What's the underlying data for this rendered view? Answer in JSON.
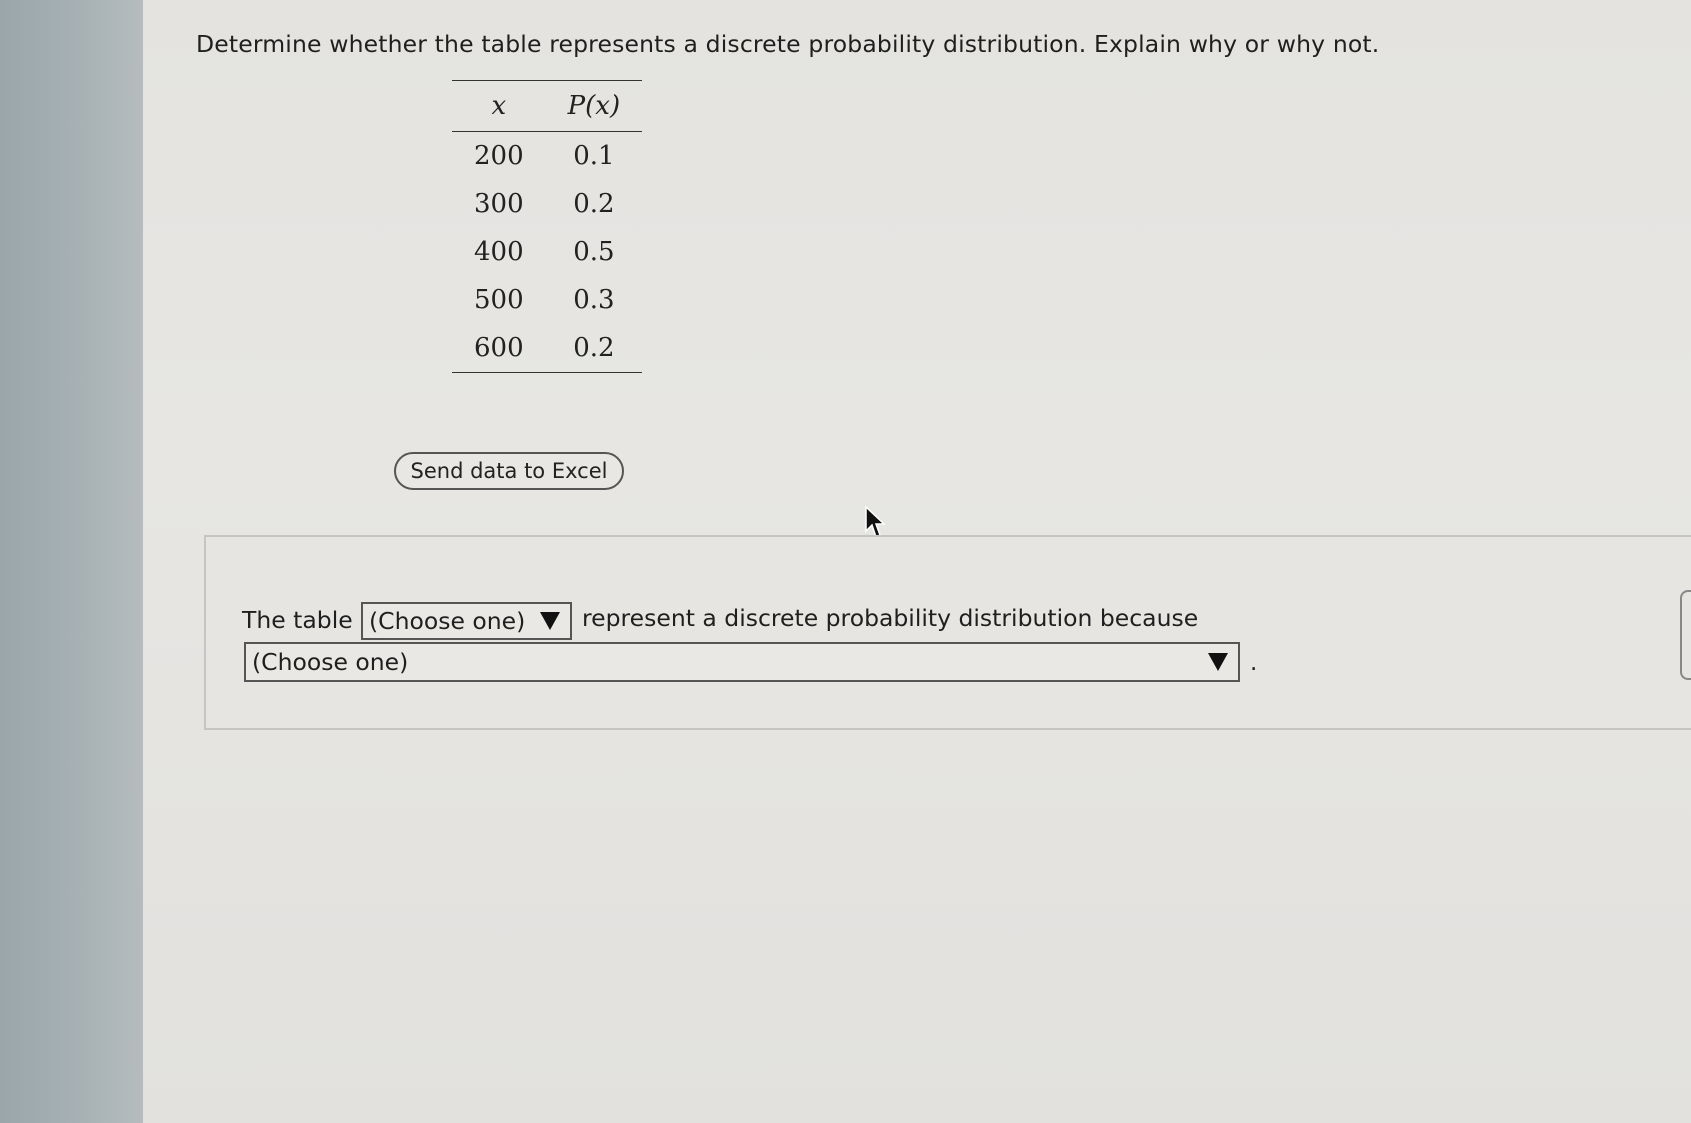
{
  "question": {
    "text": "Determine whether the table represents a discrete probability distribution. Explain why or why not."
  },
  "table": {
    "headers": [
      "x",
      "P(x)"
    ],
    "rows": [
      [
        "200",
        "0.1"
      ],
      [
        "300",
        "0.2"
      ],
      [
        "400",
        "0.5"
      ],
      [
        "500",
        "0.3"
      ],
      [
        "600",
        "0.2"
      ]
    ]
  },
  "excel_button": {
    "label": "Send data to Excel"
  },
  "answer": {
    "prefix": "The table",
    "select1_value": "(Choose one)",
    "middle": "represent a discrete probability distribution because",
    "select2_value": "(Choose one)",
    "suffix": "."
  },
  "icons": {
    "dropdown": "triangle-down-icon",
    "cursor": "mouse-pointer-icon"
  }
}
